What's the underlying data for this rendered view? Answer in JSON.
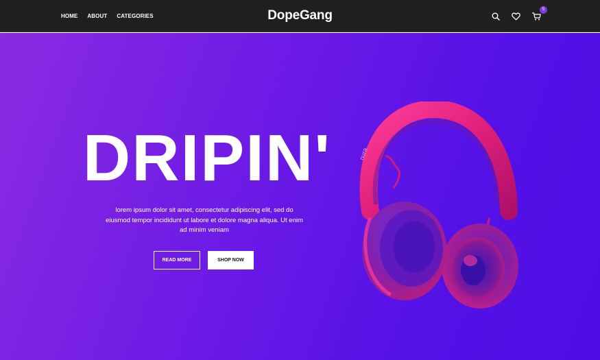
{
  "navbar": {
    "links": [
      {
        "label": "HOME"
      },
      {
        "label": "ABOUT"
      },
      {
        "label": "CATEGORIES"
      }
    ],
    "brand": "DopeGang",
    "icons": [
      "search-icon",
      "heart-icon",
      "cart-icon"
    ],
    "cart_count": "5"
  },
  "hero": {
    "title": "DRIPIN'",
    "description": "lorem ipsum dolor sit amet, consectetur adipiscing elit, sed do eiusmod tempor incididunt ut labore et dolore magna aliqua. Ut enim ad minim veniam",
    "read_more_label": "READ MORE",
    "shop_now_label": "SHOP NOW",
    "product_brand_text": "nura"
  },
  "colors": {
    "navbar_bg": "#1f1f1f",
    "hero_gradient_start": "#8a2be2",
    "hero_gradient_end": "#4f0ee4",
    "badge": "#7b3be6",
    "headphone_pink": "#e0207a"
  }
}
